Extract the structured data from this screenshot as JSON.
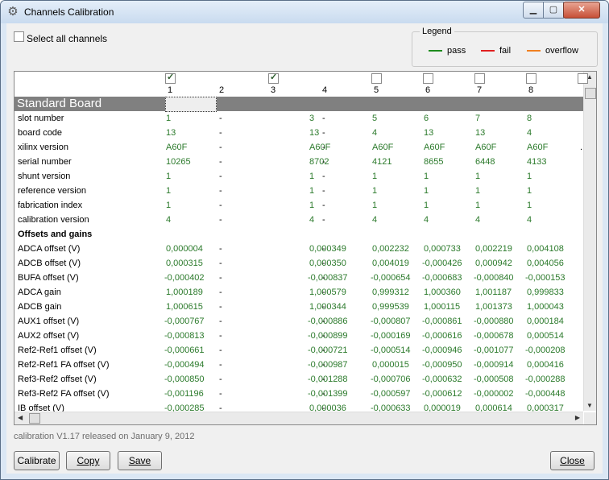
{
  "window": {
    "title": "Channels Calibration",
    "app_icon": "gear-icon",
    "minimize": "▁",
    "maximize": "▢",
    "close": "✕"
  },
  "select_all": {
    "label": "Select all channels",
    "checked": false
  },
  "legend": {
    "title": "Legend",
    "items": [
      {
        "label": "pass",
        "color": "#1e8c1e"
      },
      {
        "label": "fail",
        "color": "#e02020"
      },
      {
        "label": "overflow",
        "color": "#f08020"
      }
    ]
  },
  "columns": [
    {
      "num": "1",
      "checked": true
    },
    {
      "num": "2",
      "checked": null
    },
    {
      "num": "3",
      "checked": true
    },
    {
      "num": "4",
      "checked": null
    },
    {
      "num": "5",
      "checked": false
    },
    {
      "num": "6",
      "checked": false
    },
    {
      "num": "7",
      "checked": false
    },
    {
      "num": "8",
      "checked": false
    }
  ],
  "board_title": "Standard Board",
  "rows": [
    {
      "label": "slot number",
      "values": [
        "1",
        "-",
        "3",
        "-",
        "5",
        "6",
        "7",
        "8"
      ]
    },
    {
      "label": "board code",
      "values": [
        "13",
        "-",
        "13",
        "-",
        "4",
        "13",
        "13",
        "4"
      ]
    },
    {
      "label": "xilinx version",
      "values": [
        "A60F",
        "-",
        "A60F",
        "-",
        "A60F",
        "A60F",
        "A60F",
        "A60F"
      ]
    },
    {
      "label": "serial number",
      "values": [
        "10265",
        "-",
        "8702",
        "-",
        "4121",
        "8655",
        "6448",
        "4133"
      ]
    },
    {
      "label": "shunt version",
      "values": [
        "1",
        "-",
        "1",
        "-",
        "1",
        "1",
        "1",
        "1"
      ]
    },
    {
      "label": "reference version",
      "values": [
        "1",
        "-",
        "1",
        "-",
        "1",
        "1",
        "1",
        "1"
      ]
    },
    {
      "label": "fabrication index",
      "values": [
        "1",
        "-",
        "1",
        "-",
        "1",
        "1",
        "1",
        "1"
      ]
    },
    {
      "label": "calibration version",
      "values": [
        "4",
        "-",
        "4",
        "-",
        "4",
        "4",
        "4",
        "4"
      ]
    },
    {
      "label": "Offsets and gains",
      "section": true,
      "values": []
    },
    {
      "label": "ADCA offset (V)",
      "values": [
        "0,000004",
        "-",
        "0,000349",
        "-",
        "0,002232",
        "0,000733",
        "0,002219",
        "0,004108"
      ]
    },
    {
      "label": "ADCB offset (V)",
      "values": [
        "0,000315",
        "-",
        "0,000350",
        "-",
        "0,004019",
        "-0,000426",
        "0,000942",
        "0,004056"
      ]
    },
    {
      "label": "BUFA offset (V)",
      "values": [
        "-0,000402",
        "-",
        "-0,000837",
        "-",
        "-0,000654",
        "-0,000683",
        "-0,000840",
        "-0,000153"
      ]
    },
    {
      "label": "ADCA gain",
      "values": [
        "1,000189",
        "-",
        "1,000579",
        "-",
        "0,999312",
        "1,000360",
        "1,001187",
        "0,999833"
      ]
    },
    {
      "label": "ADCB gain",
      "values": [
        "1,000615",
        "-",
        "1,000344",
        "-",
        "0,999539",
        "1,000115",
        "1,001373",
        "1,000043"
      ]
    },
    {
      "label": "AUX1 offset (V)",
      "values": [
        "-0,000767",
        "-",
        "-0,000886",
        "-",
        "-0,000807",
        "-0,000861",
        "-0,000880",
        "0,000184"
      ]
    },
    {
      "label": "AUX2 offset (V)",
      "values": [
        "-0,000813",
        "-",
        "-0,000899",
        "-",
        "-0,000169",
        "-0,000616",
        "-0,000678",
        "0,000514"
      ]
    },
    {
      "label": "Ref2-Ref1 offset (V)",
      "values": [
        "-0,000661",
        "-",
        "-0,000721",
        "-",
        "-0,000514",
        "-0,000946",
        "-0,001077",
        "-0,000208"
      ]
    },
    {
      "label": "Ref2-Ref1 FA offset (V)",
      "values": [
        "-0,000494",
        "-",
        "-0,000987",
        "-",
        "0,000015",
        "-0,000950",
        "-0,000914",
        "0,000416"
      ]
    },
    {
      "label": "Ref3-Ref2 offset (V)",
      "values": [
        "-0,000850",
        "-",
        "-0,001288",
        "-",
        "-0,000706",
        "-0,000632",
        "-0,000508",
        "-0,000288"
      ]
    },
    {
      "label": "Ref3-Ref2 FA offset (V)",
      "values": [
        "-0,001196",
        "-",
        "-0,001399",
        "-",
        "-0,000597",
        "-0,000612",
        "-0,000002",
        "-0,000448"
      ]
    },
    {
      "label": "IB offset (V)",
      "values": [
        "-0,000285",
        "-",
        "0,000036",
        "-",
        "-0,000633",
        "0,000019",
        "0,000614",
        "0,000317"
      ]
    }
  ],
  "partial_column_value": ".",
  "status": "calibration V1.17 released on January 9, 2012",
  "buttons": {
    "calibrate": "Calibrate",
    "copy": "Copy",
    "save": "Save",
    "close": "Close"
  }
}
